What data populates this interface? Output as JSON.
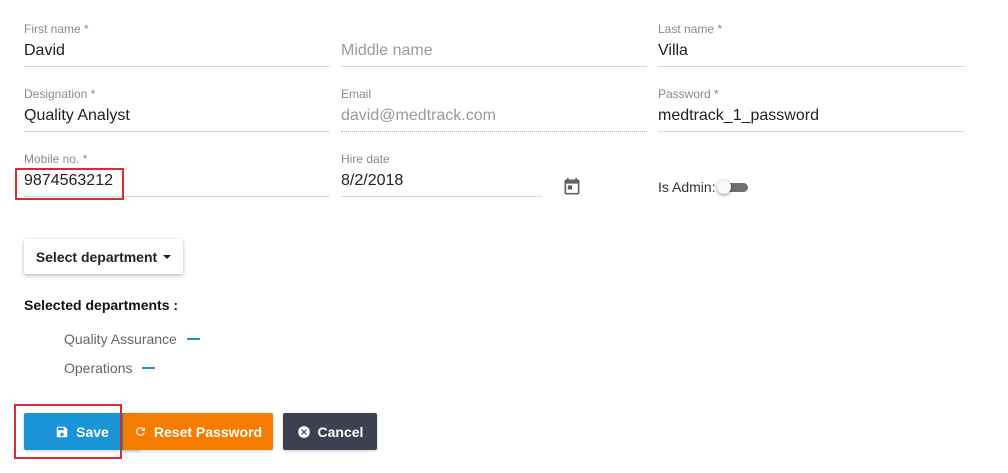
{
  "form": {
    "first_name": {
      "label": "First name *",
      "value": "David"
    },
    "middle_name": {
      "placeholder": "Middle name"
    },
    "last_name": {
      "label": "Last name *",
      "value": "Villa"
    },
    "designation": {
      "label": "Designation *",
      "value": "Quality Analyst"
    },
    "email": {
      "label": "Email",
      "value": "david@medtrack.com"
    },
    "password": {
      "label": "Password *",
      "value": "medtrack_1_password"
    },
    "mobile": {
      "label": "Mobile no. *",
      "value": "9874563212"
    },
    "hire_date": {
      "label": "Hire date",
      "value": "8/2/2018"
    },
    "is_admin": {
      "label": "Is Admin:",
      "checked": false
    }
  },
  "department": {
    "select_label": "Select department",
    "selected_title": "Selected departments :",
    "items": [
      "Quality Assurance",
      "Operations"
    ]
  },
  "actions": {
    "save_label": "Save",
    "reset_label": "Reset Password",
    "cancel_label": "Cancel"
  },
  "colors": {
    "save": "#1a94d6",
    "reset": "#f57c00",
    "cancel": "#3d4050",
    "highlight": "#d32f2f",
    "remove": "#1a94d6"
  },
  "icons": {
    "calendar": "calendar-icon",
    "save": "floppy-disk-icon",
    "reset": "refresh-icon",
    "cancel": "close-circle-icon",
    "caret": "caret-down-icon",
    "remove": "minus-icon"
  }
}
